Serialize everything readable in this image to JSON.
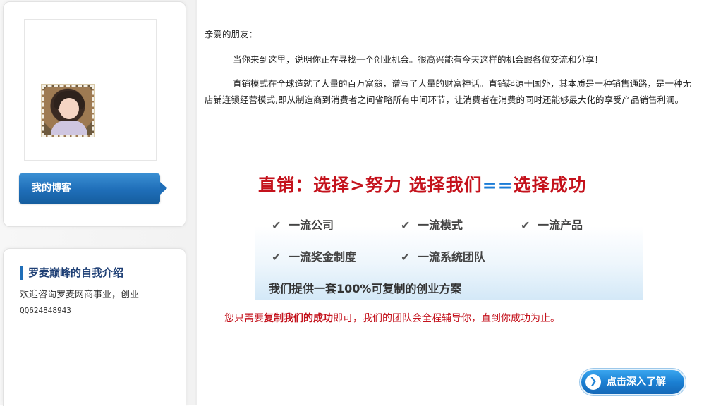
{
  "sidebar": {
    "blog_button_label": "我的博客",
    "intro_title": "罗麦巅峰的自我介绍",
    "intro_text": "欢迎咨询罗麦网商事业，创业",
    "intro_qq": "QQ624848943"
  },
  "main": {
    "greeting": "亲爱的朋友：",
    "para1": "当你来到这里，说明你正在寻找一个创业机会。很高兴能有今天这样的机会跟各位交流和分享！",
    "para2": "直销模式在全球造就了大量的百万富翁，谱写了大量的财富神话。直销起源于国外，其本质是一种销售通路，是一种无店铺连锁经营模式,即从制造商到消费者之间省略所有中间环节，让消费者在消费的同时还能够最大化的享受产品销售利润。",
    "banner_title_a": "直销：选择>努力  选择我们",
    "banner_title_eq": "==",
    "banner_title_b": "选择成功",
    "features": [
      "一流公司",
      "一流模式",
      "一流产品",
      "一流奖金制度",
      "一流系统团队"
    ],
    "offer": "我们提供一套100%可复制的创业方案",
    "notice_a": "您只需要",
    "notice_strong": "复制我们的成功",
    "notice_b": "即可，我们的团队会全程辅导你，直到你成功为止。",
    "learn_button_label": "点击深入了解"
  },
  "icons": {
    "check": "check-icon",
    "arrow": "arrow-right-icon"
  },
  "colors": {
    "accent_blue": "#1f6eb8",
    "brand_red": "#c4121c"
  }
}
